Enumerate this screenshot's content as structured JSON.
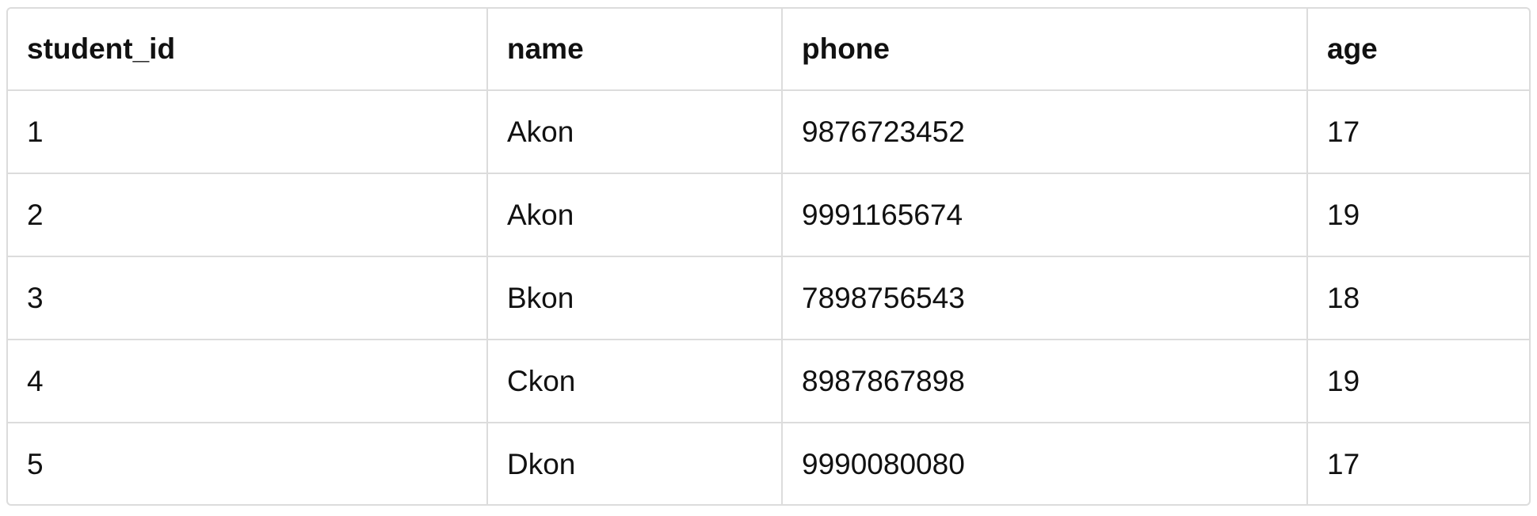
{
  "table": {
    "columns": [
      "student_id",
      "name",
      "phone",
      "age"
    ],
    "rows": [
      [
        "1",
        "Akon",
        "9876723452",
        "17"
      ],
      [
        "2",
        "Akon",
        "9991165674",
        "19"
      ],
      [
        "3",
        "Bkon",
        "7898756543",
        "18"
      ],
      [
        "4",
        "Ckon",
        "8987867898",
        "19"
      ],
      [
        "5",
        "Dkon",
        "9990080080",
        "17"
      ]
    ]
  }
}
